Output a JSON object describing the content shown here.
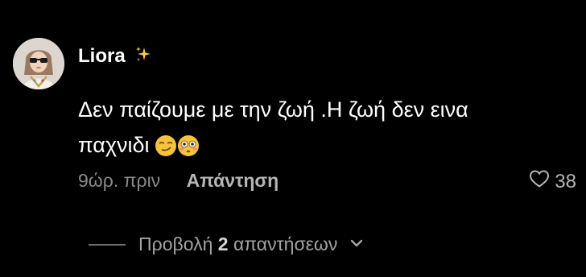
{
  "comment": {
    "username": "Liora",
    "username_badge_icon": "sparkles-icon",
    "text_line1": "Δεν παίζουμε με την ζωή .Η ζωή δεν εινα",
    "text_line2": "παχνιδι",
    "emojis": [
      "smirking-face-emoji",
      "flushed-face-emoji"
    ],
    "time_ago": "9ώρ. πριν",
    "reply_label": "Απάντηση",
    "like_count": "38",
    "like_icon": "heart-outline-icon"
  },
  "replies": {
    "prefix": "Προβολή",
    "count": "2",
    "suffix": "απαντήσεων",
    "toggle_icon": "chevron-down-icon"
  },
  "colors": {
    "background": "#000000",
    "primary_text": "#ffffff",
    "secondary_text": "#8a8a8a",
    "action_text": "#b5b5b5"
  }
}
